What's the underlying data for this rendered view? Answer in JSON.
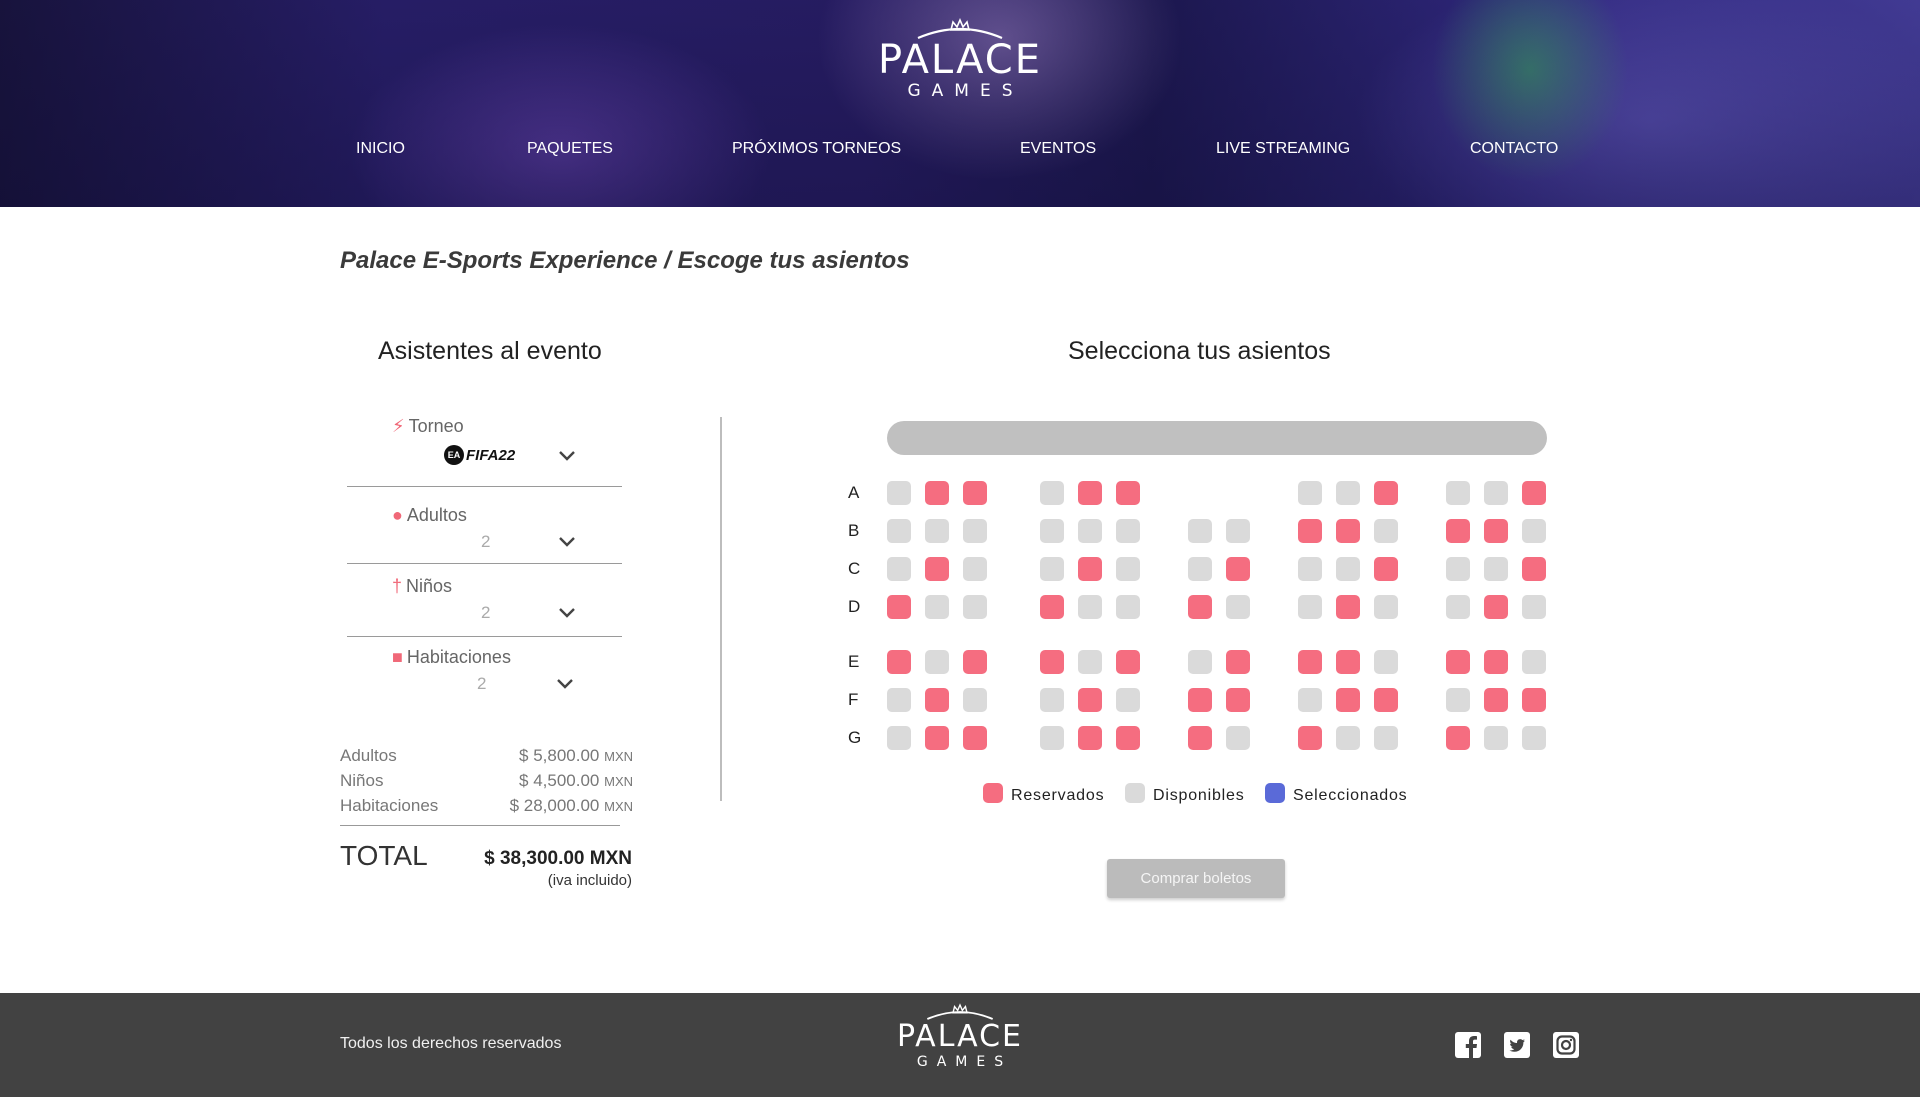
{
  "brand": {
    "line1": "PALACE",
    "line2": "GAMES"
  },
  "nav": [
    "INICIO",
    "PAQUETES",
    "PRÓXIMOS TORNEOS",
    "EVENTOS",
    "LIVE STREAMING",
    "CONTACTO"
  ],
  "page_title": "Palace E-Sports Experience / Escoge tus asientos",
  "attendees": {
    "heading": "Asistentes al evento",
    "torneo": {
      "label": "Torneo",
      "value": "FIFA22"
    },
    "adultos": {
      "label": "Adultos",
      "value": "2"
    },
    "ninos": {
      "label": "Niños",
      "value": "2"
    },
    "habitaciones": {
      "label": "Habitaciones",
      "value": "2"
    }
  },
  "prices": {
    "adultos": {
      "label": "Adultos",
      "amount": "$ 5,800.00",
      "currency": "MXN"
    },
    "ninos": {
      "label": "Niños",
      "amount": "$ 4,500.00",
      "currency": "MXN"
    },
    "habitaciones": {
      "label": "Habitaciones",
      "amount": "$ 28,000.00",
      "currency": "MXN"
    },
    "total_label": "TOTAL",
    "total_value": "$ 38,300.00 MXN",
    "total_note": "(iva incluido)"
  },
  "seats": {
    "heading": "Selecciona tus asientos",
    "rows": [
      {
        "label": "A",
        "blocks": [
          "ARR",
          "ARR",
          "",
          "AAR",
          "AAR"
        ]
      },
      {
        "label": "B",
        "blocks": [
          "AAA",
          "AAA",
          "AA",
          "RRA",
          "RRA"
        ]
      },
      {
        "label": "C",
        "blocks": [
          "ARA",
          "ARA",
          "AR",
          "AAR",
          "AAR"
        ]
      },
      {
        "label": "D",
        "blocks": [
          "RAA",
          "RAA",
          "RA",
          "ARA",
          "ARA"
        ]
      },
      {
        "label": "E",
        "blocks": [
          "RAR",
          "RAR",
          "AR",
          "RRA",
          "RRA"
        ]
      },
      {
        "label": "F",
        "blocks": [
          "ARA",
          "ARA",
          "RR",
          "ARR",
          "ARR"
        ]
      },
      {
        "label": "G",
        "blocks": [
          "ARR",
          "ARR",
          "RA",
          "RAA",
          "RAA"
        ]
      }
    ],
    "legend": {
      "reserved": "Reservados",
      "available": "Disponibles",
      "selected": "Seleccionados"
    },
    "colors": {
      "reserved": "#f56d80",
      "available": "#dadada",
      "selected": "#5a6ad8"
    }
  },
  "buy_button": "Comprar boletos",
  "footer": {
    "rights": "Todos los derechos reservados",
    "social": [
      "facebook-icon",
      "twitter-icon",
      "instagram-icon"
    ]
  }
}
